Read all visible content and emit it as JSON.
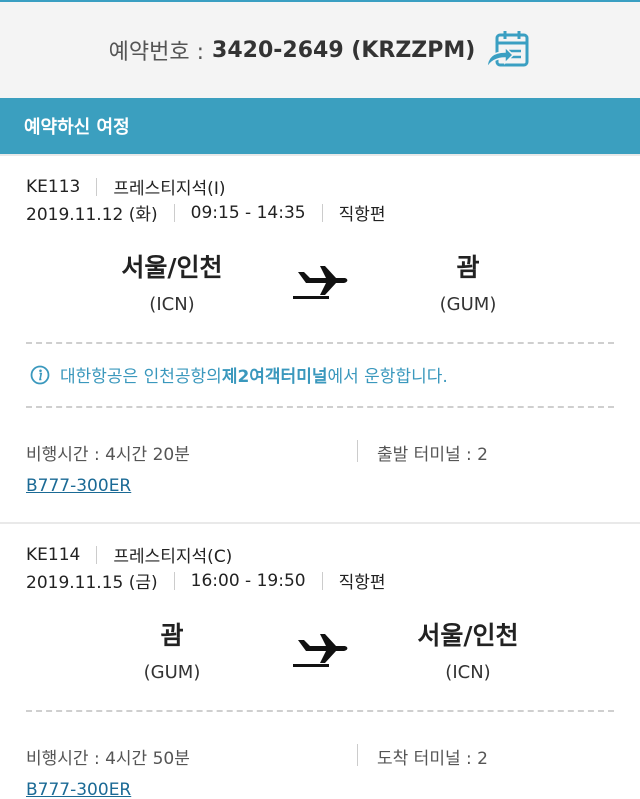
{
  "reservation": {
    "label": "예약번호 :",
    "number": "3420-2649 (KRZZPM)",
    "icon": "calendar-share-icon"
  },
  "section_title": "예약하신 여정",
  "flights": [
    {
      "flight_no": "KE113",
      "cabin": "프레스티지석(I)",
      "date": "2019.11.12 (화)",
      "time": "09:15 - 14:35",
      "type": "직항편",
      "dep_city": "서울/인천",
      "dep_code": "(ICN)",
      "arr_city": "괌",
      "arr_code": "(GUM)",
      "notice_pre": "대한항공은 인천공항의 ",
      "notice_bold": "제2여객터미널",
      "notice_post": "에서 운항합니다.",
      "duration": "비행시간 : 4시간 20분",
      "terminal": "출발 터미널 : 2",
      "aircraft": "B777-300ER"
    },
    {
      "flight_no": "KE114",
      "cabin": "프레스티지석(C)",
      "date": "2019.11.15 (금)",
      "time": "16:00 - 19:50",
      "type": "직항편",
      "dep_city": "괌",
      "dep_code": "(GUM)",
      "arr_city": "서울/인천",
      "arr_code": "(ICN)",
      "duration": "비행시간 : 4시간 50분",
      "terminal": "도착 터미널 : 2",
      "aircraft": "B777-300ER"
    }
  ],
  "colors": {
    "accent": "#3b9fbf",
    "link": "#1b6a95",
    "notice": "#3a98bd"
  }
}
